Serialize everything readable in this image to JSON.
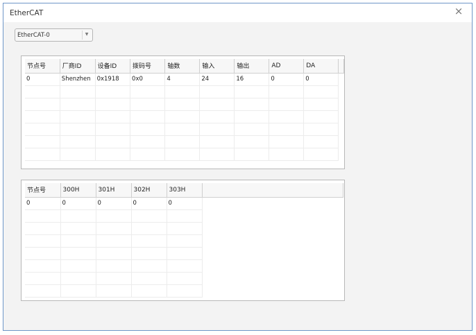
{
  "window": {
    "title": "EtherCAT",
    "close_icon": "×"
  },
  "device_select": {
    "value": "EtherCAT-0",
    "arrow": "▼"
  },
  "node_table": {
    "headers": [
      "节点号",
      "厂商ID",
      "设备ID",
      "拨码号",
      "轴数",
      "输入",
      "输出",
      "AD",
      "DA"
    ],
    "rows": [
      [
        "0",
        "Shenzhen",
        "0x1918",
        "0x0",
        "4",
        "24",
        "16",
        "0",
        "0"
      ]
    ]
  },
  "register_table": {
    "headers": [
      "节点号",
      "300H",
      "301H",
      "302H",
      "303H"
    ],
    "rows": [
      [
        "0",
        "0",
        "0",
        "0",
        "0"
      ]
    ]
  }
}
